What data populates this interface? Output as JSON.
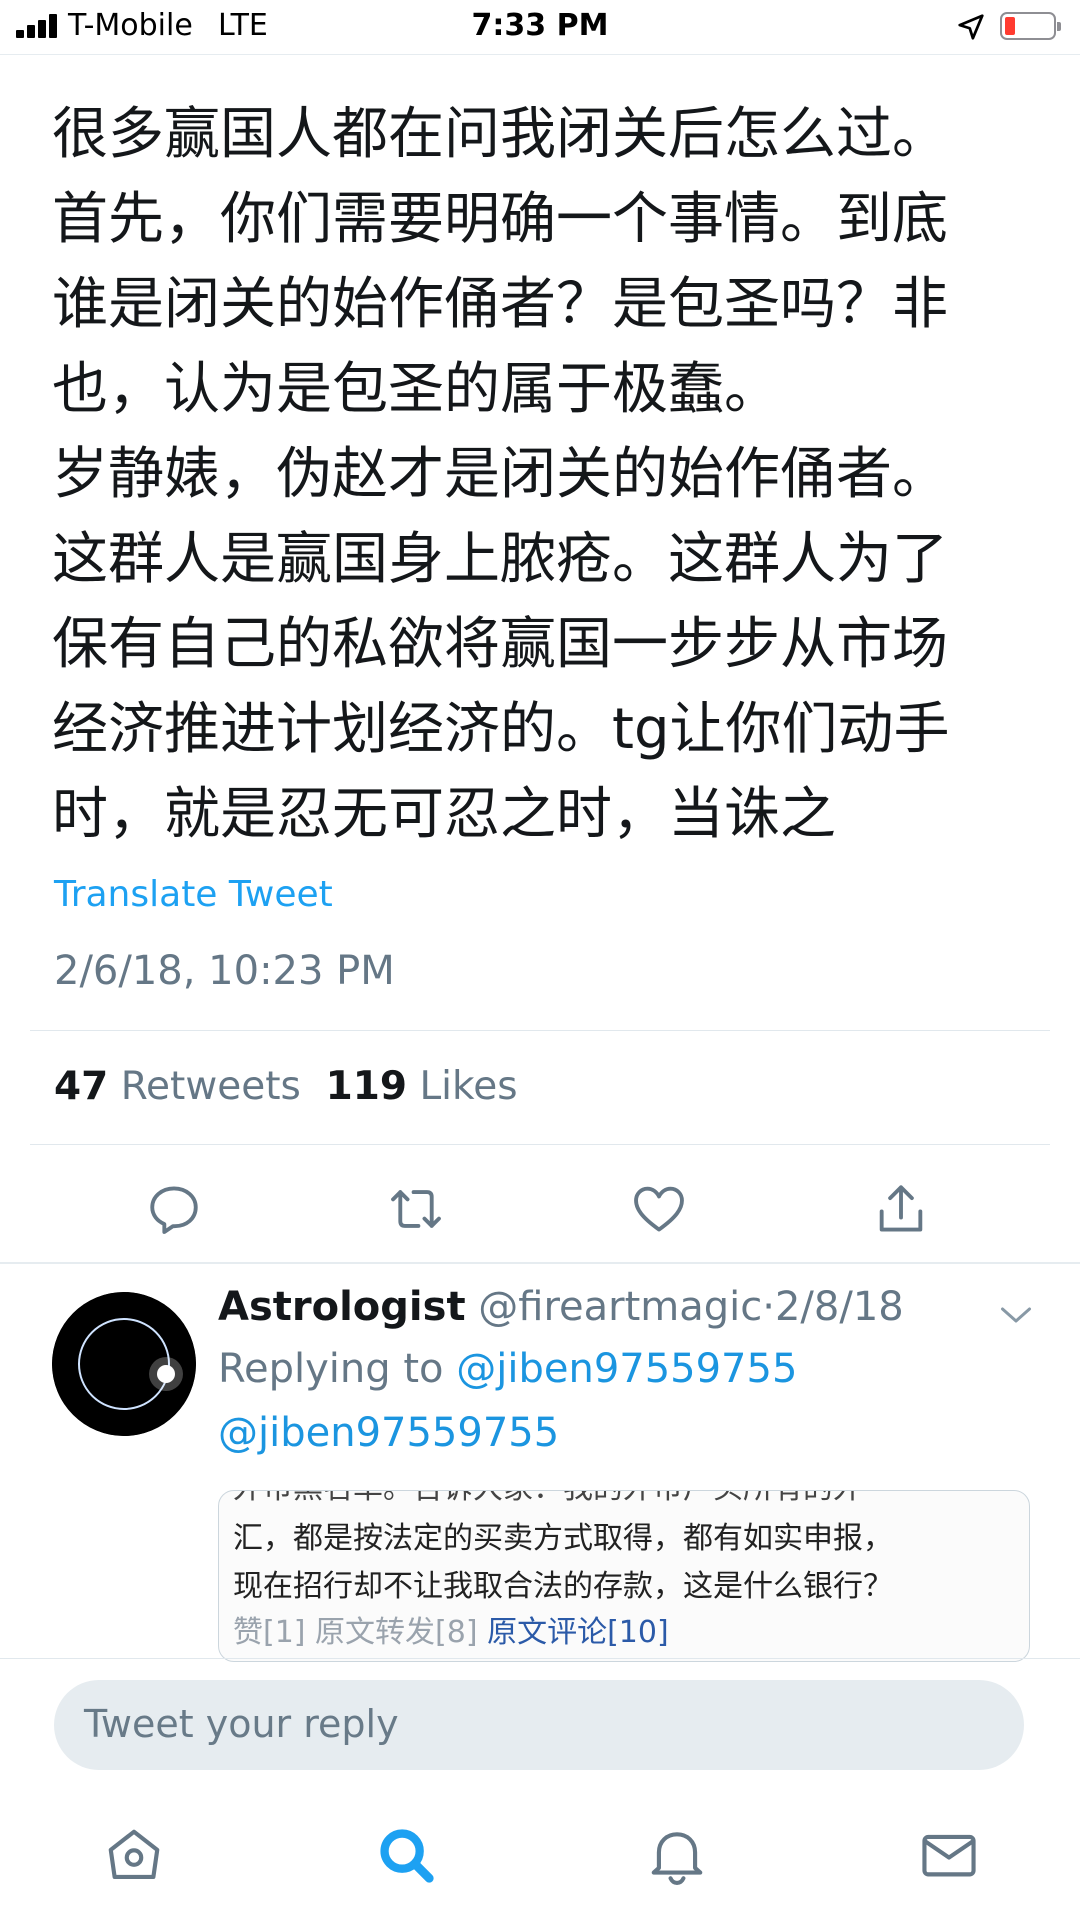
{
  "status_bar": {
    "carrier": "T-Mobile",
    "network": "LTE",
    "time": "7:33 PM",
    "battery_color": "#ff3b30"
  },
  "tweet": {
    "text_lines": [
      "很多赢国人都在问我闭关后怎么过。",
      "首先，你们需要明确一个事情。到底",
      "谁是闭关的始作俑者？是包圣吗？非",
      "也，认为是包圣的属于极蠢。",
      "岁静婊，伪赵才是闭关的始作俑者。",
      "这群人是赢国身上脓疮。这群人为了",
      "保有自己的私欲将赢国一步步从市场",
      "经济推进计划经济的。tg让你们动手",
      "时，就是忍无可忍之时，当诛之"
    ],
    "translate_label": "Translate Tweet",
    "timestamp": "2/6/18, 10:23 PM",
    "retweets_count": "47",
    "retweets_label": "Retweets",
    "likes_count": "119",
    "likes_label": "Likes",
    "actions": [
      "reply-icon",
      "retweet-icon",
      "like-icon",
      "share-icon"
    ]
  },
  "reply": {
    "name": "Astrologist",
    "handle": "@fireartmagic",
    "separator": "·",
    "date": "2/8/18",
    "replying_prefix": "Replying to",
    "replying_handle": "@jiben97559755",
    "body": "@jiben97559755",
    "image_lines": [
      "外币黑名单。告诉大家：我的外币户头所有的外",
      "汇，都是按法定的买卖方式取得，都有如实申报，",
      "现在招行却不让我取合法的存款，这是什么银行？"
    ],
    "image_footer_a": "赞[1] 原文转发[8]",
    "image_footer_link": "原文评论[10]"
  },
  "compose": {
    "placeholder": "Tweet your reply"
  },
  "tab_bar": {
    "items": [
      "home-icon",
      "search-icon",
      "notifications-icon",
      "messages-icon"
    ],
    "active": "search-icon",
    "active_color": "#1da1f2"
  }
}
